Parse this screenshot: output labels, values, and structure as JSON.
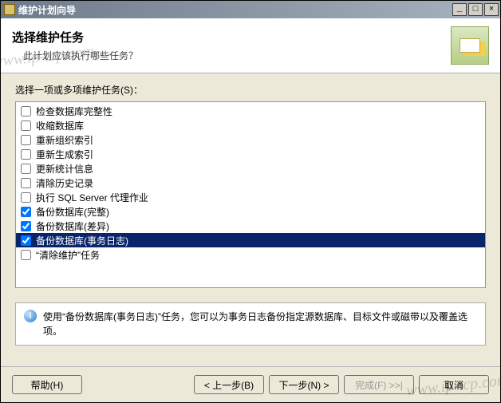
{
  "window": {
    "title": "维护计划向导"
  },
  "header": {
    "title": "选择维护任务",
    "subtitle": "此计划应该执行哪些任务？"
  },
  "tasks": {
    "label": "选择一项或多项维护任务(S)：",
    "items": [
      {
        "label": "检查数据库完整性",
        "checked": false,
        "selected": false
      },
      {
        "label": "收缩数据库",
        "checked": false,
        "selected": false
      },
      {
        "label": "重新组织索引",
        "checked": false,
        "selected": false
      },
      {
        "label": "重新生成索引",
        "checked": false,
        "selected": false
      },
      {
        "label": "更新统计信息",
        "checked": false,
        "selected": false
      },
      {
        "label": "清除历史记录",
        "checked": false,
        "selected": false
      },
      {
        "label": "执行 SQL Server 代理作业",
        "checked": false,
        "selected": false
      },
      {
        "label": "备份数据库(完整)",
        "checked": true,
        "selected": false
      },
      {
        "label": "备份数据库(差异)",
        "checked": true,
        "selected": false
      },
      {
        "label": "备份数据库(事务日志)",
        "checked": true,
        "selected": true
      },
      {
        "label": "“清除维护”任务",
        "checked": false,
        "selected": false
      }
    ]
  },
  "description": "使用“备份数据库(事务日志)”任务，您可以为事务日志备份指定源数据库、目标文件或磁带以及覆盖选项。",
  "buttons": {
    "help": "帮助(H)",
    "back": "< 上一步(B)",
    "next": "下一步(N) >",
    "finish": "完成(F) >>|",
    "cancel": "取消"
  },
  "watermarks": {
    "tl": "www.ip-tcp.com",
    "br": "www.ip-tcp.com"
  }
}
